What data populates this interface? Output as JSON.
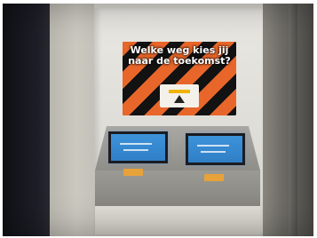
{
  "photo": {
    "description": "",
    "sign": {
      "line1": "Welke weg kies jij",
      "line2": "naar de toekomst?"
    },
    "colors": {
      "sign_orange": "#e8662a",
      "sign_black": "#121212",
      "screen_blue": "#3d93da",
      "console_grey": "#9b9a94",
      "label_orange": "#e8a23a"
    }
  }
}
